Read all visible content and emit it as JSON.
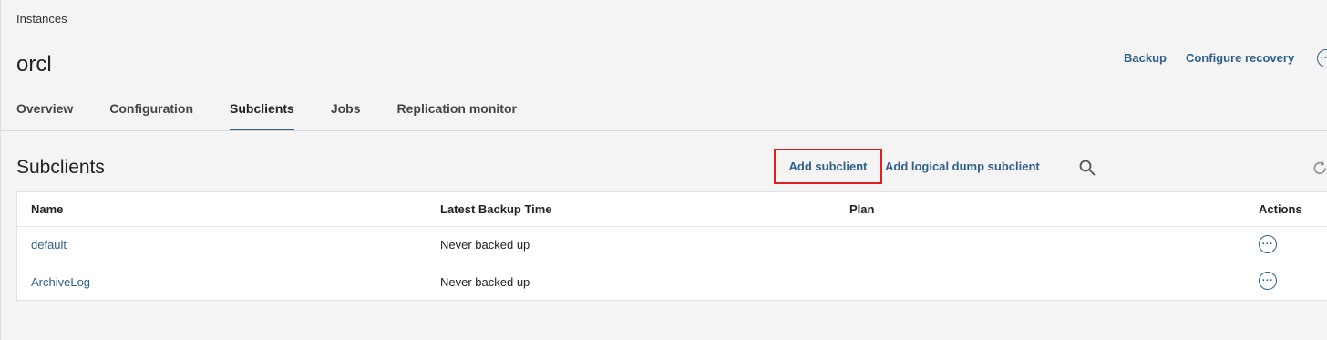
{
  "breadcrumb": "Instances",
  "title": "orcl",
  "header_actions": {
    "backup": "Backup",
    "configure_recovery": "Configure recovery"
  },
  "tabs": [
    {
      "label": "Overview",
      "active": false
    },
    {
      "label": "Configuration",
      "active": false
    },
    {
      "label": "Subclients",
      "active": true
    },
    {
      "label": "Jobs",
      "active": false
    },
    {
      "label": "Replication monitor",
      "active": false
    }
  ],
  "section": {
    "title": "Subclients",
    "add_subclient": "Add subclient",
    "add_dump_subclient": "Add logical dump subclient",
    "search_placeholder": "",
    "search_value": ""
  },
  "table": {
    "columns": [
      "Name",
      "Latest Backup Time",
      "Plan",
      "Actions"
    ],
    "rows": [
      {
        "name": "default",
        "latest_backup": "Never backed up",
        "plan": ""
      },
      {
        "name": "ArchiveLog",
        "latest_backup": "Never backed up",
        "plan": ""
      }
    ]
  },
  "icons": {
    "more": "more-options-icon",
    "search": "search-icon",
    "refresh": "refresh-icon"
  },
  "colors": {
    "accent": "#2e5f8a",
    "highlight_border": "#e0201d",
    "background": "#f4f4f4"
  }
}
